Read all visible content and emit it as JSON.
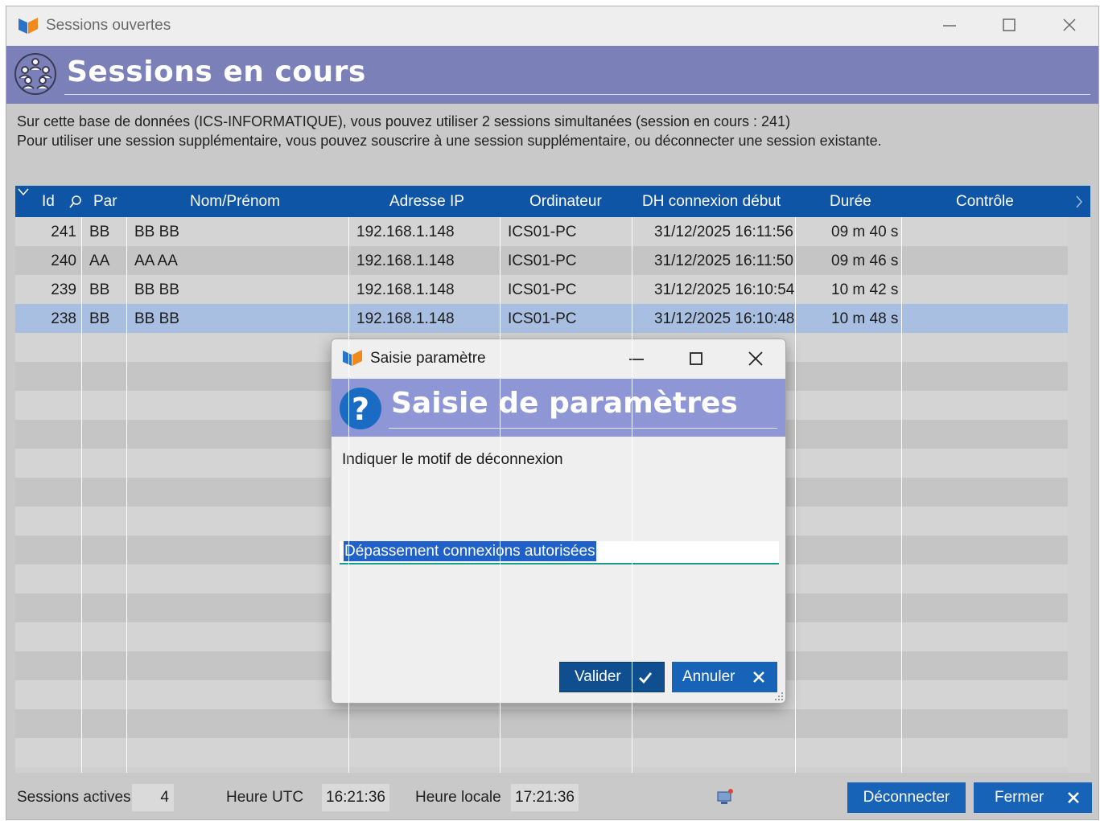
{
  "window": {
    "title": "Sessions ouvertes",
    "banner_title": "Sessions en cours"
  },
  "info": {
    "line1": "Sur cette base de données (ICS-INFORMATIQUE), vous pouvez utiliser 2 sessions simultanées (session en cours : 241)",
    "line2": "Pour utiliser une session supplémentaire, vous pouvez souscrire à une session supplémentaire, ou déconnecter une session existante."
  },
  "table": {
    "columns": [
      "Id",
      "Par",
      "Nom/Prénom",
      "Adresse IP",
      "Ordinateur",
      "DH connexion début",
      "Durée",
      "Contrôle"
    ],
    "rows": [
      {
        "id": "241",
        "par": "BB",
        "nom": "BB BB",
        "ip": "192.168.1.148",
        "ordi": "ICS01-PC",
        "dh": "31/12/2025 16:11:56",
        "duree": "09 m 40 s",
        "controle": ""
      },
      {
        "id": "240",
        "par": "AA",
        "nom": "AA AA",
        "ip": "192.168.1.148",
        "ordi": "ICS01-PC",
        "dh": "31/12/2025 16:11:50",
        "duree": "09 m 46 s",
        "controle": ""
      },
      {
        "id": "239",
        "par": "BB",
        "nom": "BB BB",
        "ip": "192.168.1.148",
        "ordi": "ICS01-PC",
        "dh": "31/12/2025 16:10:54",
        "duree": "10 m 42 s",
        "controle": ""
      },
      {
        "id": "238",
        "par": "BB",
        "nom": "BB BB",
        "ip": "192.168.1.148",
        "ordi": "ICS01-PC",
        "dh": "31/12/2025 16:10:48",
        "duree": "10 m 48 s",
        "controle": ""
      }
    ],
    "selected_row_index": 3
  },
  "status": {
    "sessions_label": "Sessions actives",
    "sessions_value": "4",
    "utc_label": "Heure UTC",
    "utc_value": "16:21:36",
    "local_label": "Heure locale",
    "local_value": "17:21:36",
    "disconnect_label": "Déconnecter",
    "close_label": "Fermer"
  },
  "dialog": {
    "title": "Saisie paramètre",
    "banner_title": "Saisie de paramètres",
    "prompt": "Indiquer le motif de déconnexion",
    "input_value": "Dépassement connexions autorisées",
    "validate_label": "Valider",
    "cancel_label": "Annuler"
  },
  "colors": {
    "banner": "#7b80b8",
    "dialog_banner": "#8f96d6",
    "grid_header": "#0e56a5",
    "selected_row": "#a9bfe2",
    "button": "#1763b8"
  }
}
